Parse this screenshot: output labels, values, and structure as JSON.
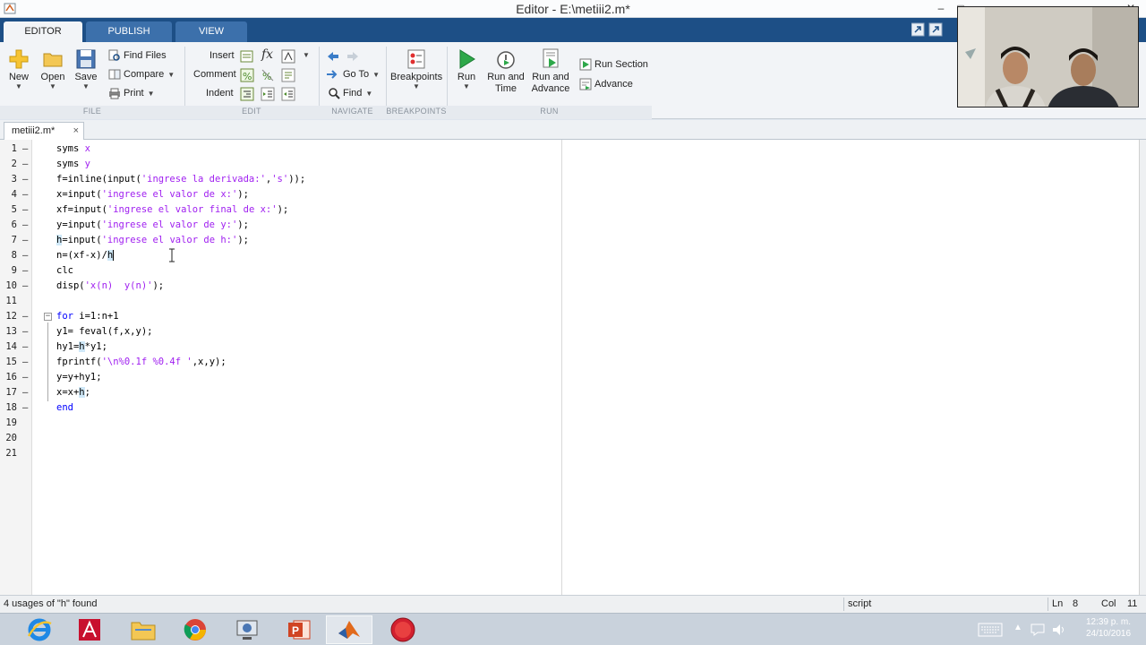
{
  "window": {
    "title": "Editor - E:\\metiii2.m*",
    "controls": [
      "–",
      "□",
      "✕"
    ]
  },
  "ribbon": {
    "tabs": [
      "EDITOR",
      "PUBLISH",
      "VIEW"
    ],
    "file": {
      "new": "New",
      "open": "Open",
      "save": "Save",
      "find_files": "Find Files",
      "compare": "Compare",
      "print": "Print",
      "section": "FILE"
    },
    "edit": {
      "insert": "Insert",
      "comment": "Comment",
      "indent": "Indent",
      "fx": "fx",
      "section": "EDIT"
    },
    "navigate": {
      "goto": "Go To",
      "find": "Find",
      "section": "NAVIGATE"
    },
    "breakpoints": {
      "label": "Breakpoints",
      "section": "BREAKPOINTS"
    },
    "run": {
      "run": "Run",
      "run_and_time": [
        "Run and",
        "Time"
      ],
      "run_and_advance": [
        "Run and",
        "Advance"
      ],
      "run_section": "Run Section",
      "advance": "Advance",
      "section": "RUN"
    }
  },
  "file_tab": {
    "name": "metiii2.m*",
    "close": "×"
  },
  "editor": {
    "lines": [
      {
        "n": "1",
        "d": "–",
        "code": [
          [
            "syms ",
            ""
          ],
          [
            "x",
            "str"
          ]
        ]
      },
      {
        "n": "2",
        "d": "–",
        "code": [
          [
            "syms ",
            ""
          ],
          [
            "y",
            "str"
          ]
        ]
      },
      {
        "n": "3",
        "d": "–",
        "code": [
          [
            "f=inline(input(",
            ""
          ],
          [
            "'ingrese la derivada:'",
            "str"
          ],
          [
            ",",
            ""
          ],
          [
            "'s'",
            "str"
          ],
          [
            "));",
            ""
          ]
        ]
      },
      {
        "n": "4",
        "d": "–",
        "code": [
          [
            "x=input(",
            ""
          ],
          [
            "'ingrese el valor de x:'",
            "str"
          ],
          [
            ");",
            ""
          ]
        ]
      },
      {
        "n": "5",
        "d": "–",
        "code": [
          [
            "xf=input(",
            ""
          ],
          [
            "'ingrese el valor final de x:'",
            "str"
          ],
          [
            ");",
            ""
          ]
        ]
      },
      {
        "n": "6",
        "d": "–",
        "code": [
          [
            "y=input(",
            ""
          ],
          [
            "'ingrese el valor de y:'",
            "str"
          ],
          [
            ");",
            ""
          ]
        ]
      },
      {
        "n": "7",
        "d": "–",
        "code": [
          [
            "h",
            "hl"
          ],
          [
            "=input(",
            ""
          ],
          [
            "'ingrese el valor de h:'",
            "str"
          ],
          [
            ");",
            ""
          ]
        ]
      },
      {
        "n": "8",
        "d": "–",
        "code": [
          [
            "n=(xf-x)/",
            ""
          ],
          [
            "h",
            "hl"
          ]
        ]
      },
      {
        "n": "9",
        "d": "–",
        "code": [
          [
            "clc",
            ""
          ]
        ]
      },
      {
        "n": "10",
        "d": "–",
        "code": [
          [
            "disp(",
            ""
          ],
          [
            "'x(n)  y(n)'",
            "str"
          ],
          [
            ");",
            ""
          ]
        ]
      },
      {
        "n": "11",
        "d": "",
        "code": []
      },
      {
        "n": "12",
        "d": "–",
        "code": [
          [
            "for",
            "kw"
          ],
          [
            " i=1:n+1",
            ""
          ]
        ]
      },
      {
        "n": "13",
        "d": "–",
        "code": [
          [
            "y1= feval(f,x,y);",
            ""
          ]
        ]
      },
      {
        "n": "14",
        "d": "–",
        "code": [
          [
            "hy1=",
            ""
          ],
          [
            "h",
            "hl"
          ],
          [
            "*y1;",
            ""
          ]
        ]
      },
      {
        "n": "15",
        "d": "–",
        "code": [
          [
            "fprintf(",
            ""
          ],
          [
            "'\\n%0.1f %0.4f '",
            "str"
          ],
          [
            ",x,y);",
            ""
          ]
        ]
      },
      {
        "n": "16",
        "d": "–",
        "code": [
          [
            "y=y+hy1;",
            ""
          ]
        ]
      },
      {
        "n": "17",
        "d": "–",
        "code": [
          [
            "x=x+",
            ""
          ],
          [
            "h",
            "hl"
          ],
          [
            ";",
            ""
          ]
        ]
      },
      {
        "n": "18",
        "d": "–",
        "code": [
          [
            "end",
            "kw"
          ]
        ]
      },
      {
        "n": "19",
        "d": "",
        "code": []
      },
      {
        "n": "20",
        "d": "",
        "code": []
      },
      {
        "n": "21",
        "d": "",
        "code": []
      }
    ]
  },
  "status": {
    "message": "4 usages of \"h\" found",
    "mode": "script",
    "ln_label": "Ln",
    "ln_value": "8",
    "col_label": "Col",
    "col_value": "11"
  },
  "taskbar": {
    "time": "12:39 p. m.",
    "date": "24/10/2016"
  }
}
